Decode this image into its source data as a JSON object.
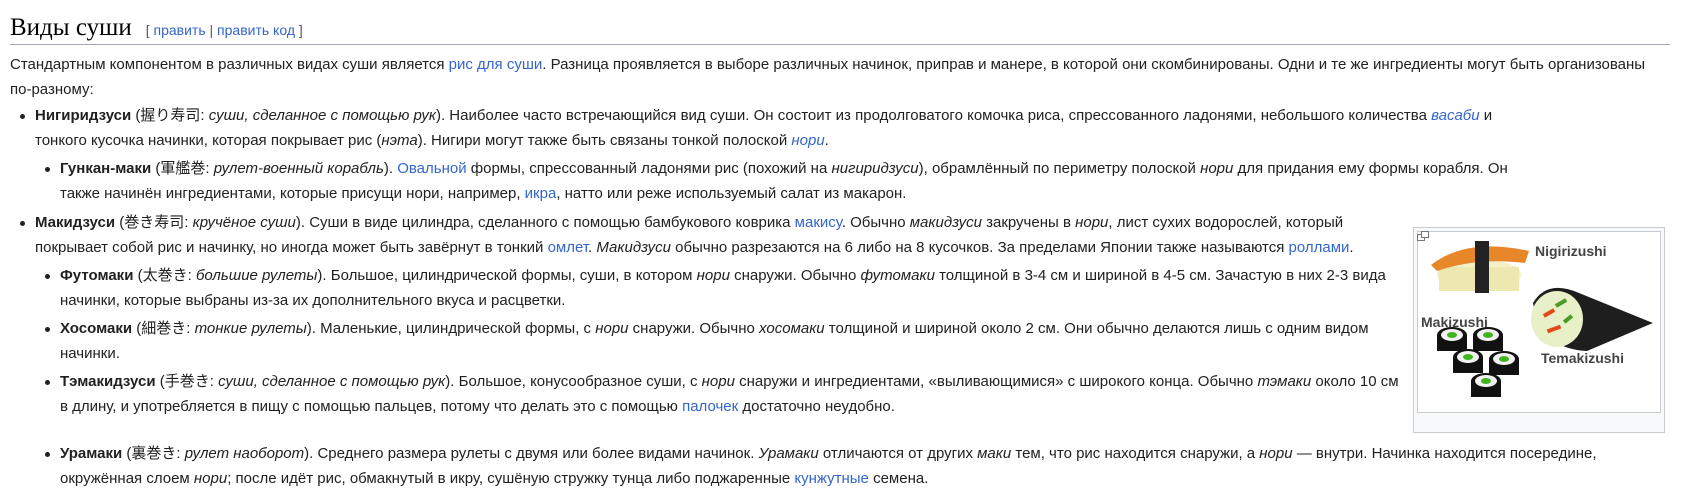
{
  "heading": {
    "title": "Виды суши",
    "edit_open": "[ ",
    "edit": "править",
    "sep": " | ",
    "edit_code": "править код",
    "edit_close": " ]"
  },
  "intro": {
    "t1": "Стандартным компонентом в различных видах суши является ",
    "link_rice": "рис для суши",
    "t2": ". Разница проявляется в выборе различных начинок, приправ и манере, в которой они скомбинированы. Одни и те же ингредиенты могут быть организованы по-разному:"
  },
  "nigiri": {
    "name": "Нигиридзуси",
    "jp": "握り寿司",
    "trans": "суши, сделанное с помощью рук",
    "t1": ". Наиболее часто встречающийся вид суши. Он состоит из продолговатого комочка риса, спрессованного ладонями, небольшого количества ",
    "link_wasabi": "васаби",
    "t2": " и тонкого кусочка начинки, которая покрывает рис (",
    "neta": "нэта",
    "t3": "). Нигири могут также быть связаны тонкой полоской ",
    "link_nori": "нори",
    "t4": "."
  },
  "gunkan": {
    "name": "Гункан-маки",
    "jp": "軍艦巻",
    "trans": "рулет-военный корабль",
    "t1": ". ",
    "link_oval": "Овальной",
    "t2": " формы, спрессованный ладонями рис (похожий на ",
    "nigiri_i": "нигиридзуси",
    "t3": "), обрамлённый по периметру полоской ",
    "nori_i": "нори",
    "t4": " для придания ему формы корабля. Он также начинён ингредиентами, которые присущи нори, например, ",
    "link_ikra": "икра",
    "t5": ", натто или реже используемый салат из макарон."
  },
  "maki": {
    "name": "Макидзуси",
    "jp": "巻き寿司",
    "trans": "кручёное суши",
    "t1": ". Суши в виде цилиндра, сделанного с помощью бамбукового коврика ",
    "link_makisu": "макису",
    "t2": ". Обычно ",
    "maki_i": "макидзуси",
    "t3": " закручены в ",
    "nori_i": "нори",
    "t4": ", лист сухих водорослей, который покрывает собой рис и начинку, но иногда может быть завёрнут в тонкий ",
    "link_omlet": "омлет",
    "t5": ". ",
    "maki_i2": "Макидзуси",
    "t6": " обычно разрезаются на 6 либо на 8 кусочков. За пределами Японии также называются ",
    "link_rolls": "роллами",
    "t7": "."
  },
  "futo": {
    "name": "Футомаки",
    "jp": "太巻き",
    "trans": "большие рулеты",
    "t1": ". Большое, цилиндрической формы, суши, в котором ",
    "nori_i": "нори",
    "t2": " снаружи. Обычно ",
    "futo_i": "футомаки",
    "t3": " толщиной в 3-4 см и шириной в 4-5 см. Зачастую в них 2-3 вида начинки, которые выбраны из-за их дополнительного вкуса и расцветки."
  },
  "hoso": {
    "name": "Хосомаки",
    "jp": "細巻き",
    "trans": "тонкие рулеты",
    "t1": ". Маленькие, цилиндрической формы, с ",
    "nori_i": "нори",
    "t2": " снаружи. Обычно ",
    "hoso_i": "хосомаки",
    "t3": " толщиной и шириной около 2 см. Они обычно делаются лишь с одним видом начинки."
  },
  "temaki": {
    "name": "Тэмакидзуси",
    "jp": "手巻き",
    "trans": "суши, сделанное с помощью рук",
    "t1": ". Большое, конусообразное суши, с ",
    "nori_i": "нори",
    "t2": " снаружи и ингредиентами, «выливающимися» с широкого конца. Обычно ",
    "temaki_i": "тэмаки",
    "t3": " около 10 см в длину, и употребляется в пищу с помощью пальцев, потому что делать это с помощью ",
    "link_sticks": "палочек",
    "t4": " достаточно неудобно."
  },
  "ura": {
    "name": "Урамаки",
    "jp": "裏巻き",
    "trans": "рулет наоборот",
    "t1": ". Среднего размера рулеты с двумя или более видами начинок. ",
    "ura_i": "Урамаки",
    "t2": " отличаются от других ",
    "maki_i": "маки",
    "t3": " тем, что рис находится снаружи, а ",
    "nori_i": "нори",
    "t4": " — внутри. Начинка находится посередине, окружённая слоем ",
    "nori_i2": "нори",
    "t5": "; после идёт рис, обмакнутый в икру, сушёную стружку тунца либо поджаренные ",
    "link_sesame": "кунжутные",
    "t6": " семена."
  },
  "thumb": {
    "nigirizushi": "Nigirizushi",
    "makizushi": "Makizushi",
    "temakizushi": "Temakizushi"
  },
  "colors": {
    "link": "#3366cc",
    "text": "#202122"
  }
}
